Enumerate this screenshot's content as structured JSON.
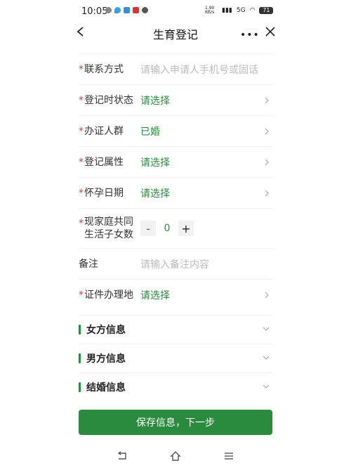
{
  "status_bar": {
    "time": "10:05",
    "speed": "1.90 KB/s",
    "net": "5G",
    "battery": "71"
  },
  "header": {
    "title": "生育登记"
  },
  "form": {
    "contact": {
      "label": "联系方式",
      "placeholder": "请输入申请人手机号或固话"
    },
    "reg_status": {
      "label": "登记时状态",
      "value": "请选择"
    },
    "applicant_group": {
      "label": "办证人群",
      "value": "已婚"
    },
    "reg_attr": {
      "label": "登记属性",
      "value": "请选择"
    },
    "pregnancy_date": {
      "label": "怀孕日期",
      "value": "请选择"
    },
    "children": {
      "label_line1": "现家庭共同",
      "label_line2": "生活子女数",
      "value": "0",
      "minus": "-",
      "plus": "+"
    },
    "remark": {
      "label": "备注",
      "placeholder": "请输入备注内容"
    },
    "cert_place": {
      "label": "证件办理地",
      "value": "请选择"
    }
  },
  "sections": {
    "female": "女方信息",
    "male": "男方信息",
    "marriage": "结婚信息"
  },
  "save_button": "保存信息，下一步",
  "colors": {
    "accent": "#2a8a3e",
    "required": "#e03b3b"
  }
}
